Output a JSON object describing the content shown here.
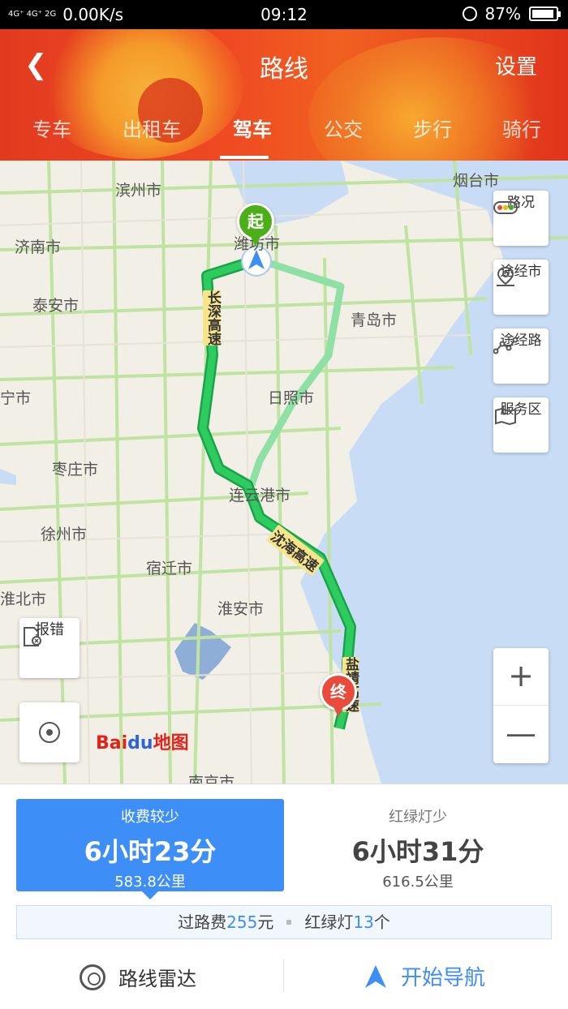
{
  "status_bar": {
    "signal": "4G⁺ 4G⁺ 2G",
    "speed": "0.00K/s",
    "time": "09:12",
    "battery": "87%"
  },
  "header": {
    "title": "路线",
    "settings": "设置",
    "tabs": [
      "专车",
      "出租车",
      "驾车",
      "公交",
      "步行",
      "骑行"
    ],
    "active_tab": "驾车"
  },
  "map": {
    "cities": [
      "滨州市",
      "烟台市",
      "济南市",
      "潍坊市",
      "泰安市",
      "青岛市",
      "宁市",
      "日照市",
      "枣庄市",
      "连云港市",
      "徐州市",
      "宿迁市",
      "淮北市",
      "淮安市",
      "南京市"
    ],
    "road_labels": [
      "长深高速",
      "沈海高速",
      "盐靖高速"
    ],
    "start_marker": "起",
    "end_marker": "终",
    "side_buttons": [
      "路况",
      "途经市",
      "途经路",
      "服务区"
    ],
    "report_button": "报错",
    "logo_text": "Bai",
    "logo_du": "du",
    "logo_map": "地图"
  },
  "routes": [
    {
      "name": "收费较少",
      "time": "6小时23分",
      "distance": "583.8公里",
      "selected": true
    },
    {
      "name": "红绿灯少",
      "time": "6小时31分",
      "distance": "616.5公里",
      "selected": false
    }
  ],
  "summary": {
    "toll_label": "过路费",
    "toll_value": "255",
    "toll_unit": "元",
    "lights_label": "红绿灯",
    "lights_value": "13",
    "lights_unit": "个"
  },
  "actions": {
    "radar": "路线雷达",
    "navigate": "开始导航"
  },
  "colors": {
    "header": "#e8401f",
    "accent_blue": "#3e8ef7",
    "route_main": "#1db954",
    "route_alt": "#8fe0a4"
  }
}
